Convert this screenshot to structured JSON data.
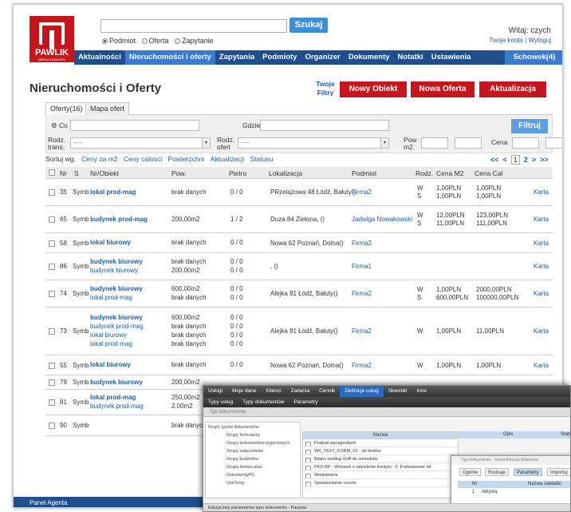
{
  "colors": {
    "brand_red": "#c4161c",
    "nav_blue": "#1f4e8c",
    "link_blue": "#1a5ea8",
    "button_blue": "#3b8fd6"
  },
  "logo": {
    "name": "PAWLIK",
    "sub": "NIERUCHOMOŚCI"
  },
  "search": {
    "button": "Szukaj",
    "value": "",
    "options": [
      "Podmiot",
      "Oferta",
      "Zapytanie"
    ],
    "selected": "Podmiot"
  },
  "welcome": {
    "text": "Witaj: czych",
    "account": "Twoje konto",
    "logout": "Wyloguj"
  },
  "nav": {
    "items": [
      "Aktualności",
      "Nieruchomości i oferty",
      "Zapytania",
      "Podmioty",
      "Organizer",
      "Dokumenty",
      "Notatki",
      "Ustawienia"
    ],
    "active": "Nieruchomości i oferty",
    "schowek": "Schowek(4)"
  },
  "page": {
    "title": "Nieruchomości i Oferty",
    "twoje_filtry": "Twoje Filtry",
    "buttons": {
      "new_object": "Nowy Obiekt",
      "new_offer": "Nowa Oferta",
      "update": "Aktualizacja"
    }
  },
  "tabs": [
    "Oferty(16)",
    "Mapa ofert"
  ],
  "filters": {
    "co": "Co",
    "gdzie": "Gdzie",
    "rodz_trans": "Rodz. trans.",
    "rodz_ofert": "Rodz. ofert",
    "pow": "Pow m2",
    "cena": "Cena",
    "select_placeholder": "-----",
    "filtruj": "Filtruj"
  },
  "sort": {
    "label": "Sortuj wg:",
    "options": [
      "Ceny za m2",
      "Ceny calosci",
      "Powierzchni",
      "Aktualizacji",
      "Statusu"
    ]
  },
  "pager": {
    "first": "<<",
    "prev": "<",
    "current": "1",
    "next_page": "2",
    "next": ">",
    "last": ">>"
  },
  "table": {
    "headers": [
      "Nr",
      "S",
      "Nr/Obiekt",
      "Pow.",
      "Pietro",
      "Lokalizacja",
      "Podmiot",
      "Rodz.",
      "Cena M2",
      "Cena Cal"
    ],
    "rows": [
      {
        "nr": "35",
        "s": "Symb",
        "obiekt": [
          "lokal prod-mag"
        ],
        "pow": [
          "brak danych"
        ],
        "pietro": [
          "0 / 0"
        ],
        "lok": "PRzelążowa 48 Łódź, Bałuty()",
        "podmiot": "Firma2",
        "rodz": [
          "W",
          "S"
        ],
        "cm2": [
          "1,00PLN",
          "1,00PLN"
        ],
        "ccal": [
          "1,00PLN",
          "1,00PLN"
        ],
        "karta": "Karta"
      },
      {
        "nr": "65",
        "s": "Symb",
        "obiekt": [
          "budynek prod-mag"
        ],
        "pow": [
          "200,00m2"
        ],
        "pietro": [
          "1 / 2"
        ],
        "lok": "Duza 84 Zielona, ()",
        "podmiot": "Jadwiga Nowakowski",
        "rodz": [
          "W",
          "S"
        ],
        "cm2": [
          "12,00PLN",
          "11,00PLN"
        ],
        "ccal": [
          "123,00PLN",
          "111,00PLN"
        ],
        "karta": "Karta"
      },
      {
        "nr": "58",
        "s": "Symb",
        "obiekt": [
          "lokal biurowy"
        ],
        "pow": [
          "brak danych"
        ],
        "pietro": [
          "0 / 0"
        ],
        "lok": "Nowa 62 Poznań, Dolna()",
        "podmiot": "Firma2",
        "rodz": [],
        "cm2": [],
        "ccal": [],
        "karta": "Karta"
      },
      {
        "nr": "86",
        "s": "Symb",
        "obiekt": [
          "budynek biurowy",
          "budynek biurowy"
        ],
        "pow": [
          "brak danych",
          "200.00m2"
        ],
        "pietro": [
          "0 / 0",
          "0 / 0"
        ],
        "lok": ", ()",
        "podmiot": "Firma1",
        "rodz": [],
        "cm2": [],
        "ccal": [],
        "karta": "Karta"
      },
      {
        "nr": "74",
        "s": "Symb",
        "obiekt": [
          "budynek biurowy",
          "lokal prod-mag"
        ],
        "pow": [
          "600,00m2",
          "brak danych"
        ],
        "pietro": [
          "0 / 0",
          "0 / 0"
        ],
        "lok": "Alejka 91 Łódź, Bałuty()",
        "podmiot": "Firma2",
        "rodz": [
          "W",
          "S"
        ],
        "cm2": [
          "1,00PLN",
          "600,00PLN"
        ],
        "ccal": [
          "2000,00PLN",
          "100000,00PLN"
        ],
        "karta": "Karta"
      },
      {
        "nr": "73",
        "s": "Symb",
        "obiekt": [
          "budynek biurowy",
          "budynek prod-mag",
          "lokal biurowy",
          "lokal prod-mag"
        ],
        "pow": [
          "600,00m2",
          "brak danych",
          "brak danych",
          "brak danych"
        ],
        "pietro": [
          "0 / 0",
          "0 / 0",
          "0 / 0",
          "0 / 0"
        ],
        "lok": "Alejka 91 Łódź, Bałuty()",
        "podmiot": "Firma2",
        "rodz": [
          "W"
        ],
        "cm2": [
          "1,00PLN"
        ],
        "ccal": [
          "11,00PLN"
        ],
        "karta": "Karta"
      },
      {
        "nr": "55",
        "s": "Symb",
        "obiekt": [
          "lokal biurowy"
        ],
        "pow": [
          "brak danych"
        ],
        "pietro": [
          "0 / 0"
        ],
        "lok": "Nowa 62 Poznań, Dolna()",
        "podmiot": "Firma2",
        "rodz": [
          "W"
        ],
        "cm2": [
          "1,00PLN"
        ],
        "ccal": [
          "1,00PLN"
        ],
        "karta": "Karta"
      },
      {
        "nr": "79",
        "s": "Symb",
        "obiekt": [
          "budynek biurowy"
        ],
        "pow": [
          "200,00m2"
        ],
        "pietro": [],
        "lok": "",
        "podmiot": "",
        "rodz": [],
        "cm2": [],
        "ccal": [],
        "karta": ""
      },
      {
        "nr": "81",
        "s": "Symb",
        "obiekt": [
          "lokal prod-mag",
          "budynek prod-mag"
        ],
        "pow": [
          "250,00m2",
          "2.00m2"
        ],
        "pietro": [],
        "lok": "",
        "podmiot": "",
        "rodz": [],
        "cm2": [],
        "ccal": [],
        "karta": ""
      },
      {
        "nr": "90",
        "s": "Symb",
        "obiekt": [],
        "pow": [
          "brak danych"
        ],
        "pietro": [],
        "lok": "",
        "podmiot": "",
        "rodz": [],
        "cm2": [],
        "ccal": [],
        "karta": ""
      }
    ]
  },
  "footer": {
    "text": "Panel Agenta"
  },
  "overlay": {
    "toolbar": [
      "Usługi",
      "Moje dane",
      "Klienci",
      "Zadania",
      "Cennik",
      "Definicje usług",
      "Słowniki",
      "Inne"
    ],
    "toolbar_active": "Definicje usług",
    "toolbar2": [
      "Typy usług",
      "Typy dokumentów",
      "Parametry"
    ],
    "bar": "Typ dokumentów",
    "tree": [
      "Grupy typów dokumentów",
      "Grupy formularzy",
      "Grupy dokumentów wyjściowych",
      "Grupy załączników",
      "Grupy budżetów",
      "Grupa biznes plan",
      "DokumentyPC",
      "UnitTesty"
    ],
    "table_header": "Nazwa",
    "table_rows": [
      "Podział wynagrodzeń",
      "WK_TEST_FORM_X1 - do testów",
      "Bilans według UoR do wniosków",
      "PKO BP - Wniosek o udzielenie kredytu - II. Podstawowe inf",
      "Wiekowanie",
      "Sprawozdanie roczne"
    ],
    "col2_header": "Opis",
    "col3_header": "Statu",
    "dialog": {
      "title": "Typ dokumentu - Konsolidacja bilansów",
      "tabs": [
        "Ogólne",
        "Rodzaje",
        "Parametry",
        "Importuj"
      ],
      "active_tab": "Parametry",
      "col_nr": "Nr",
      "col_name": "Nazwa zakładki",
      "row_nr": "1",
      "row_name": "Aktywa"
    },
    "status": "Edycja listy parametrów typu dokumentu - Pasywa"
  }
}
